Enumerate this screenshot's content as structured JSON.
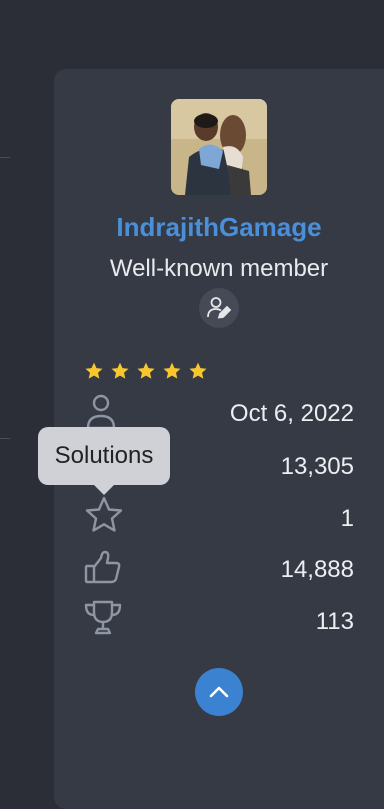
{
  "profile": {
    "username": "IndrajithGamage",
    "member_title": "Well-known member",
    "rating_stars": 5
  },
  "stats": [
    {
      "icon": "user-icon",
      "value": "Oct 6, 2022"
    },
    {
      "icon": "message-icon",
      "value": "13,305"
    },
    {
      "icon": "star-outline-icon",
      "value": "1"
    },
    {
      "icon": "thumbs-up-icon",
      "value": "14,888"
    },
    {
      "icon": "trophy-icon",
      "value": "113"
    }
  ],
  "tooltip": {
    "label": "Solutions"
  },
  "colors": {
    "background": "#2b2e37",
    "card": "#363a45",
    "username": "#4a8fd8",
    "star": "#f7c72d",
    "scroll_button": "#3b83d1"
  }
}
